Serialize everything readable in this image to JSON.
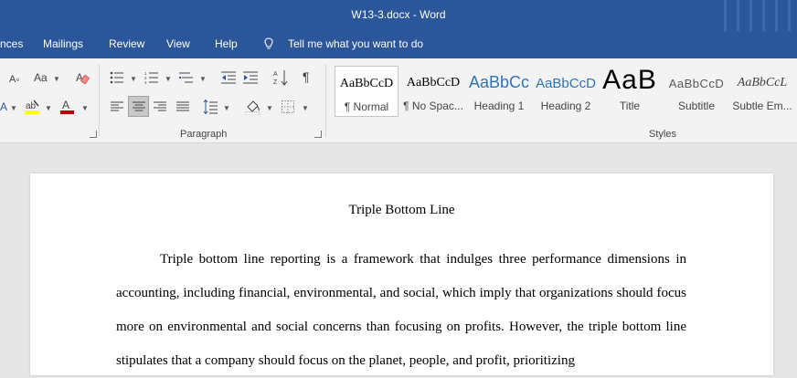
{
  "window": {
    "title": "W13-3.docx  -  Word"
  },
  "menu": {
    "references_partial": "nces",
    "mailings": "Mailings",
    "review": "Review",
    "view": "View",
    "help": "Help",
    "tell_me": "Tell me what you want to do"
  },
  "ribbon": {
    "paragraph_label": "Paragraph",
    "styles_label": "Styles",
    "font_case_glyph": "Aa",
    "styles": [
      {
        "preview": "AaBbCcD",
        "name": "¶ Normal"
      },
      {
        "preview": "AaBbCcD",
        "name": "¶ No Spac..."
      },
      {
        "preview": "AaBbCc",
        "name": "Heading 1"
      },
      {
        "preview": "AaBbCcD",
        "name": "Heading 2"
      },
      {
        "preview": "AaB",
        "name": "Title"
      },
      {
        "preview": "AaBbCcD",
        "name": "Subtitle"
      },
      {
        "preview": "AaBbCcL",
        "name": "Subtle Em..."
      }
    ]
  },
  "colors": {
    "accent": "#2b579a",
    "highlight": "#ffff00",
    "font_color": "#c00000",
    "heading": "#2e74b5"
  },
  "document": {
    "title": "Triple Bottom Line",
    "paragraph": "Triple bottom line reporting is a framework that indulges three performance dimensions in accounting, including financial, environmental, and social, which imply that organizations should focus more on environmental and social concerns than focusing on profits. However, the triple bottom line stipulates that a company should focus on the planet, people, and profit, prioritizing"
  }
}
